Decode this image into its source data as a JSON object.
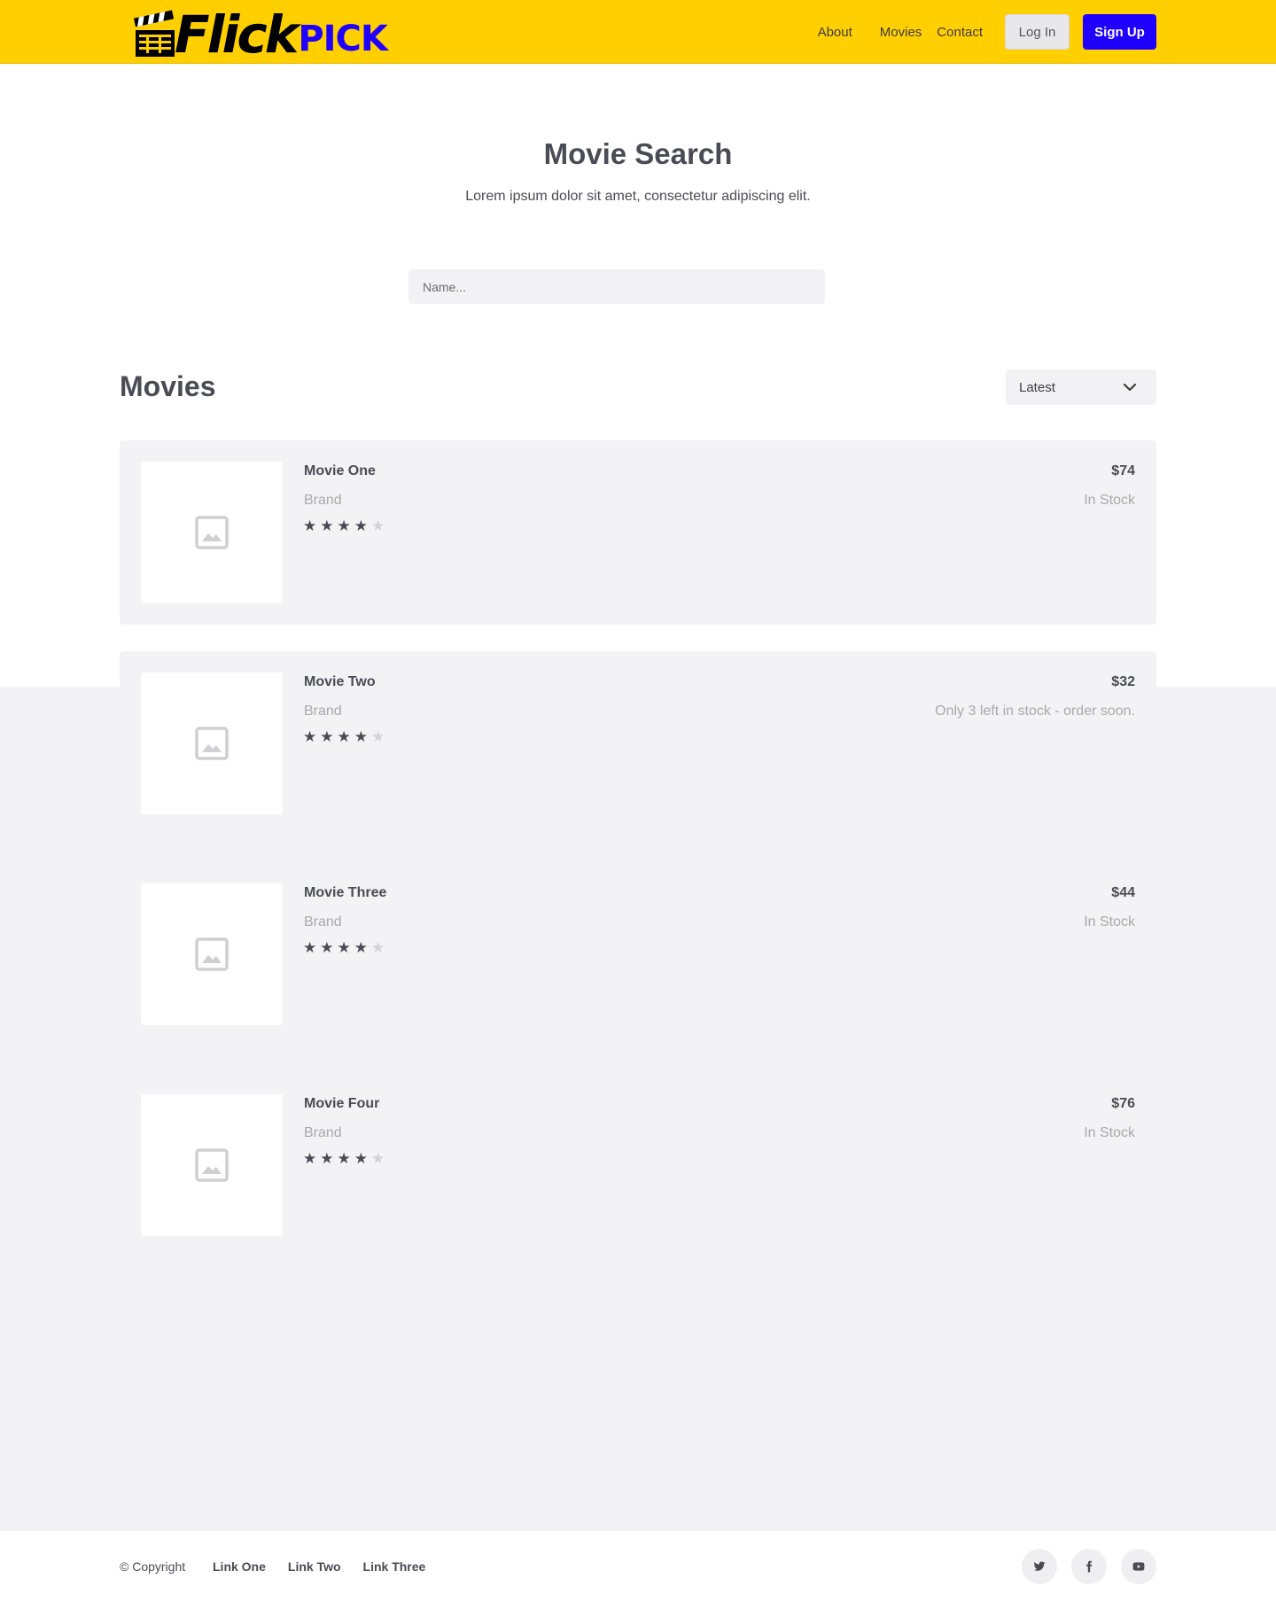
{
  "header": {
    "logo_word": "Flick",
    "logo_accent": "PICK",
    "nav": [
      "About",
      "Movies",
      "Contact"
    ],
    "login_label": "Log In",
    "signup_label": "Sign Up"
  },
  "hero": {
    "title": "Movie Search",
    "subtitle": "Lorem ipsum dolor sit amet, consectetur adipiscing elit.",
    "search_placeholder": "Name..."
  },
  "movies": {
    "heading": "Movies",
    "sort_selected": "Latest",
    "items": [
      {
        "title": "Movie One",
        "brand": "Brand",
        "rating": 4,
        "max_rating": 5,
        "price": "$74",
        "stock": "In Stock"
      },
      {
        "title": "Movie Two",
        "brand": "Brand",
        "rating": 4,
        "max_rating": 5,
        "price": "$32",
        "stock": "Only 3 left in stock - order soon."
      },
      {
        "title": "Movie Three",
        "brand": "Brand",
        "rating": 4,
        "max_rating": 5,
        "price": "$44",
        "stock": "In Stock"
      },
      {
        "title": "Movie Four",
        "brand": "Brand",
        "rating": 4,
        "max_rating": 5,
        "price": "$76",
        "stock": "In Stock"
      }
    ]
  },
  "footer": {
    "copyright": "© Copyright",
    "links": [
      "Link One",
      "Link Two",
      "Link Three"
    ],
    "socials": [
      "twitter-icon",
      "facebook-icon",
      "youtube-icon"
    ]
  },
  "colors": {
    "header_bg": "#ffcf00",
    "accent_blue": "#1f00ff",
    "text_dark": "#4b4b55",
    "text_muted": "#a8a8ae",
    "panel_gray": "#f3f3f5"
  }
}
